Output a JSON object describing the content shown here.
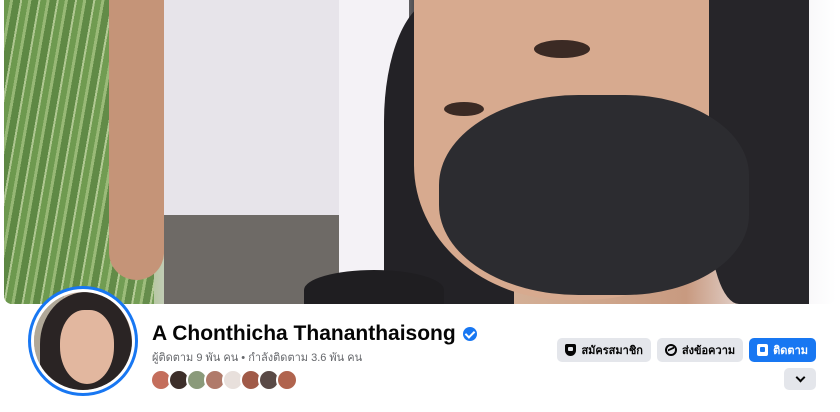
{
  "profile": {
    "name": "A Chonthicha Thananthaisong",
    "followers_text": "ผู้ติดตาม 9 พัน คน",
    "separator": " • ",
    "following_text": "กำลังติดตาม 3.6 พัน คน"
  },
  "friends": {
    "avatar_colors": [
      "#c46e5c",
      "#3d2f2a",
      "#8a9a7a",
      "#b07a6a",
      "#e8e0dc",
      "#a05a48",
      "#5a4a46",
      "#b0644e"
    ]
  },
  "actions": {
    "subscribe_label": "สมัครสมาชิก",
    "message_label": "ส่งข้อความ",
    "follow_label": "ติดตาม"
  },
  "colors": {
    "accent": "#1877f2",
    "button_grey": "#e4e6eb",
    "text_primary": "#050505",
    "text_secondary": "#65676b"
  },
  "icons": {
    "verified": "verified-badge-icon",
    "subscribe": "shield-icon",
    "message": "messenger-icon",
    "follow": "follow-icon",
    "more": "chevron-down-icon"
  }
}
